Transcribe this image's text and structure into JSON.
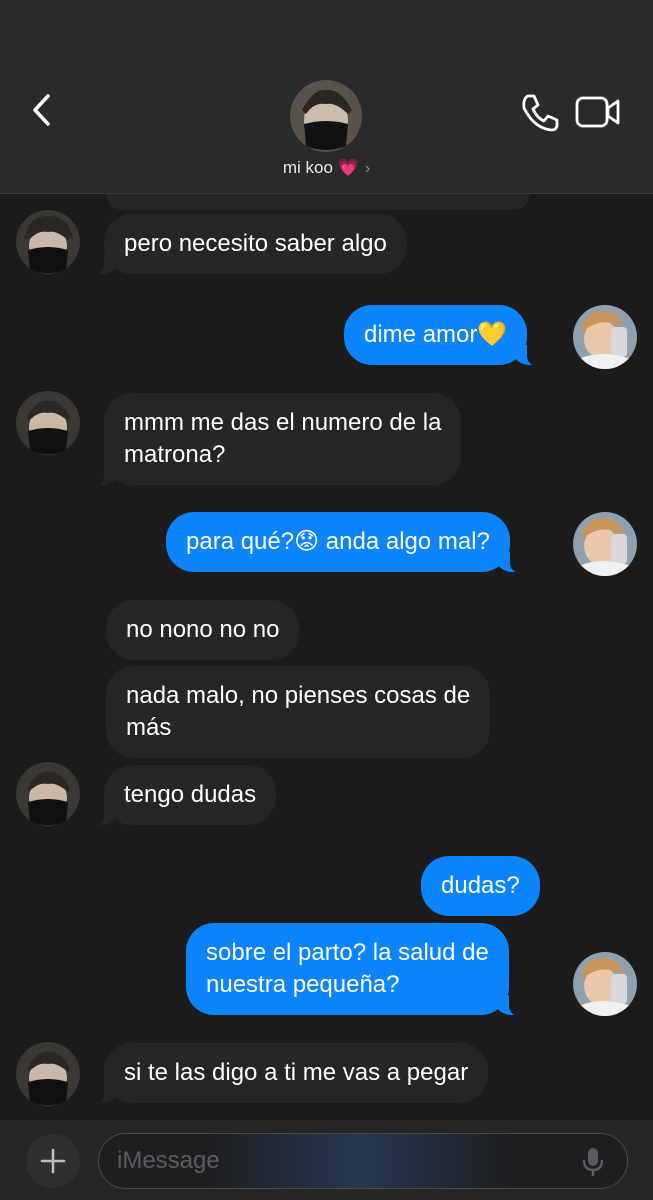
{
  "header": {
    "contact_name": "mi koo 💗",
    "chevron": "›"
  },
  "messages": [
    {
      "dir": "in",
      "text": "pero necesito saber algo"
    },
    {
      "dir": "out",
      "text": "dime amor💛"
    },
    {
      "dir": "in",
      "lines": [
        "mmm me das el numero de la",
        "matrona?"
      ]
    },
    {
      "dir": "out",
      "text": "para qué?😟 anda algo mal?"
    },
    {
      "dir": "in",
      "text": "no nono no no"
    },
    {
      "dir": "in",
      "lines": [
        "nada malo, no pienses cosas de",
        "más"
      ]
    },
    {
      "dir": "in",
      "text": "tengo dudas"
    },
    {
      "dir": "out",
      "text": "dudas?"
    },
    {
      "dir": "out",
      "lines": [
        "sobre el parto? la salud de",
        "nuestra pequeña?"
      ]
    },
    {
      "dir": "in",
      "text": "si te las digo a ti me vas a pegar"
    }
  ],
  "composer": {
    "placeholder": "iMessage"
  },
  "colors": {
    "background": "#1c1c1d",
    "incoming_bubble": "#262628",
    "outgoing_bubble": "#0b84fe",
    "header": "#2a2a2b"
  },
  "icons": {
    "back": "chevron-left-icon",
    "call": "phone-icon",
    "video": "video-camera-icon",
    "add": "plus-icon",
    "dictate": "microphone-icon"
  }
}
